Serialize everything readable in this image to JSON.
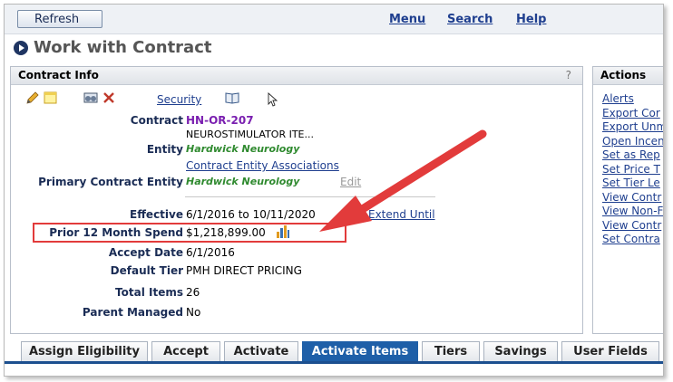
{
  "toolbar": {
    "refresh_label": "Refresh",
    "menu_label": "Menu",
    "search_label": "Search",
    "help_label": "Help"
  },
  "page": {
    "title": "Work with Contract"
  },
  "contract_info": {
    "header": "Contract Info",
    "help": "?",
    "security_label": "Security",
    "fields": {
      "contract_label": "Contract",
      "contract_value": "HN-OR-207",
      "contract_description": "NEUROSTIMULATOR ITE...",
      "entity_label": "Entity",
      "entity_value": "Hardwick Neurology",
      "associations_link": "Contract Entity Associations",
      "primary_entity_label": "Primary Contract Entity",
      "primary_entity_value": "Hardwick Neurology",
      "edit_link": "Edit",
      "effective_label": "Effective",
      "effective_value": "6/1/2016 to 10/11/2020",
      "extend_link": "Extend Until",
      "spend_label": "Prior 12 Month Spend",
      "spend_value": "$1,218,899.00",
      "accept_label": "Accept Date",
      "accept_value": "6/1/2016",
      "tier_label": "Default Tier",
      "tier_value": "PMH DIRECT PRICING",
      "total_label": "Total Items",
      "total_value": "26",
      "parent_label": "Parent Managed",
      "parent_value": "No"
    }
  },
  "actions": {
    "header": "Actions",
    "items": [
      "Alerts",
      "Export Cor",
      "Export Unm",
      "Open Incen",
      "Set as Rep",
      "Set Price T",
      "Set Tier Le",
      "View Contr",
      "View Non-F",
      "View Contr",
      "Set Contra"
    ]
  },
  "tabs": [
    "Assign Eligibility",
    "Accept",
    "Activate",
    "Activate Items",
    "Tiers",
    "Savings",
    "User Fields"
  ],
  "active_tab": "Activate Items",
  "colors": {
    "annotation": "#e23b3b",
    "active_tab": "#1e5fa8",
    "link": "#1f3f8f",
    "contract_id": "#7a1fb0",
    "entity": "#2f8a2f"
  },
  "icons": [
    "pencil-icon",
    "note-icon",
    "binoculars-icon",
    "delete-icon",
    "book-icon",
    "mouse-cursor-icon",
    "chart-icon",
    "page-title-icon"
  ]
}
